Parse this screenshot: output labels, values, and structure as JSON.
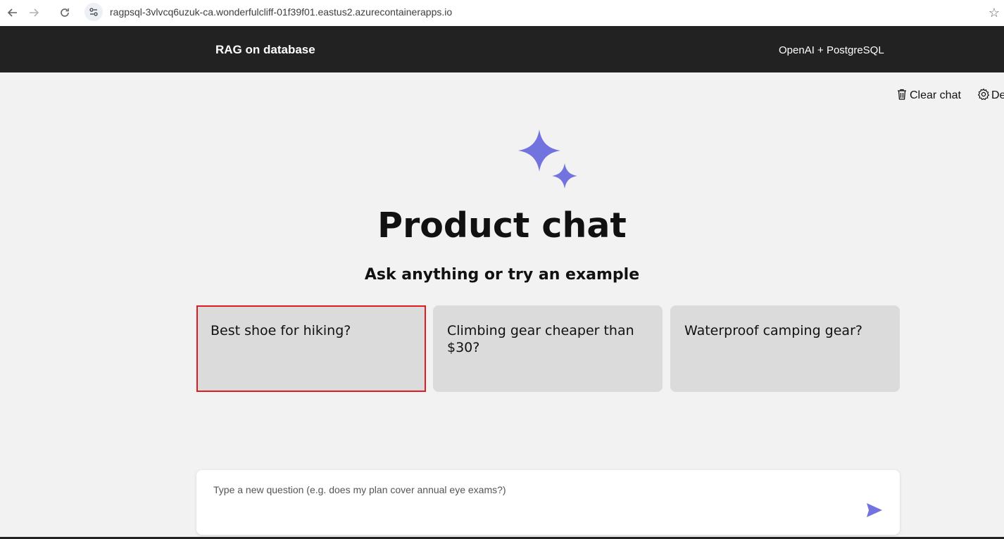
{
  "browser": {
    "url": "ragpsql-3vlvcq6uzuk-ca.wonderfulcliff-01f39f01.eastus2.azurecontainerapps.io",
    "back_icon": "back-arrow-icon",
    "forward_icon": "forward-arrow-icon",
    "reload_icon": "reload-icon",
    "bookmark_icon": "star-icon"
  },
  "header": {
    "title": "RAG on database",
    "subtitle": "OpenAI + PostgreSQL"
  },
  "commands": {
    "clear_chat": "Clear chat",
    "developer_settings": "De"
  },
  "main": {
    "title": "Product chat",
    "subtitle": "Ask anything or try an example",
    "examples": [
      {
        "label": "Best shoe for hiking?",
        "selected": true
      },
      {
        "label": "Climbing gear cheaper than $30?",
        "selected": false
      },
      {
        "label": "Waterproof camping gear?",
        "selected": false
      }
    ]
  },
  "question": {
    "placeholder": "Type a new question (e.g. does my plan cover annual eye exams?)",
    "value": ""
  },
  "colors": {
    "accent": "#7373e0",
    "header_bg": "#222222",
    "page_bg": "#f2f2f2",
    "card_bg": "#dbdbdb",
    "selection_outline": "#e01b24"
  }
}
